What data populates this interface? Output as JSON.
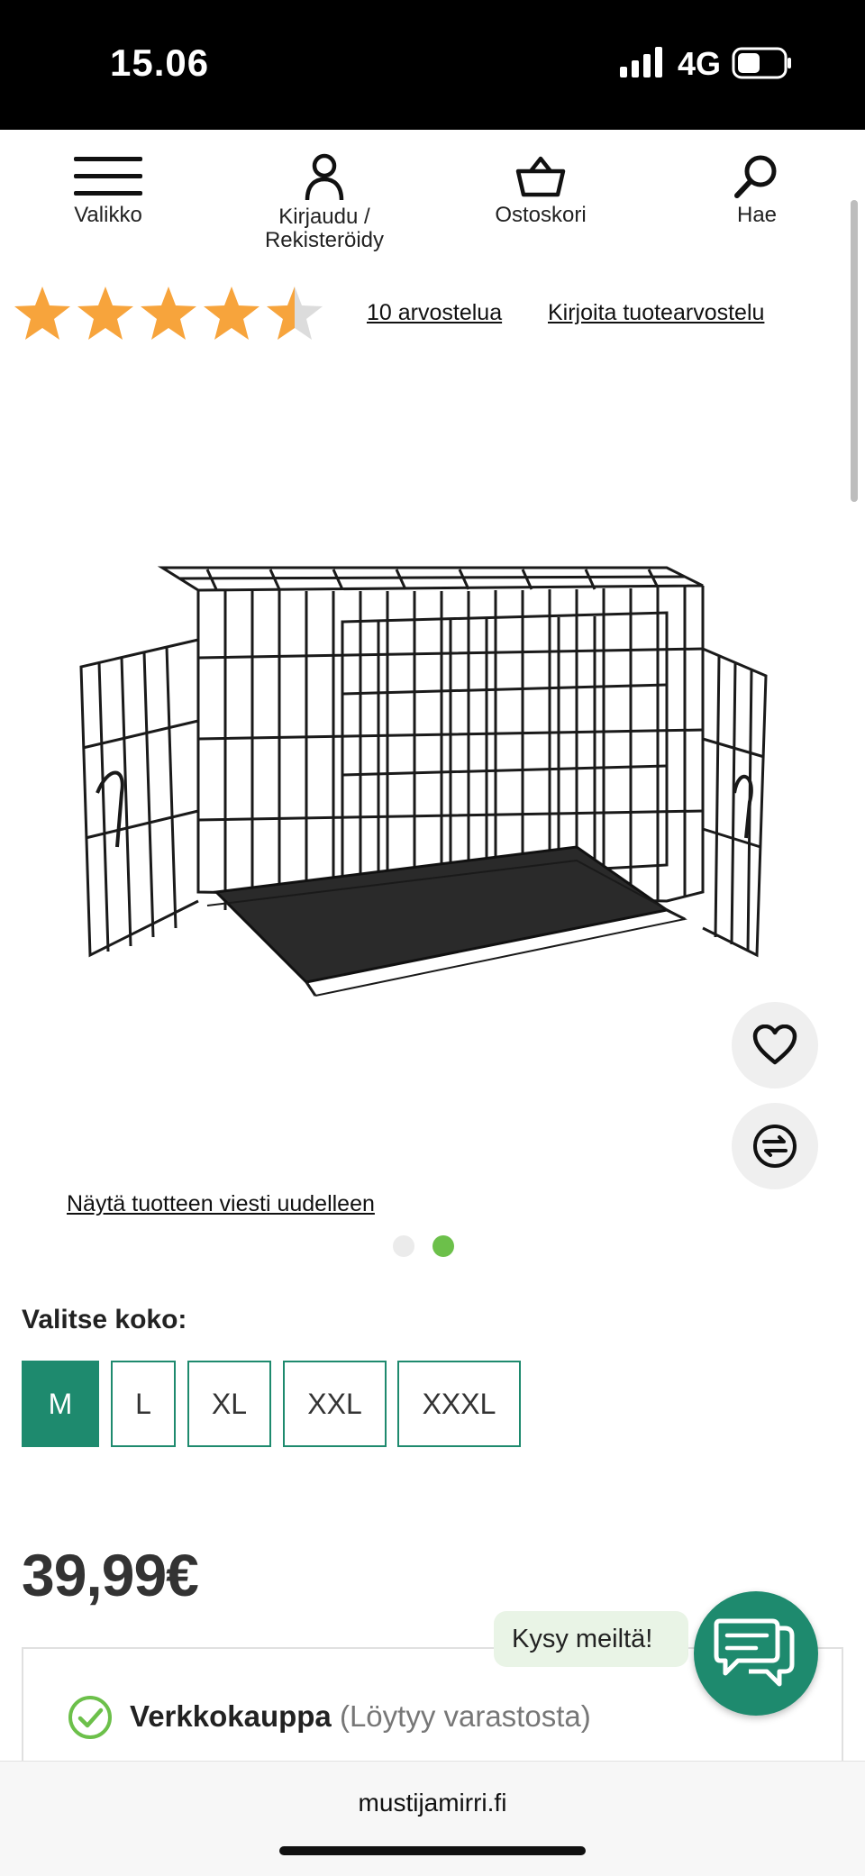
{
  "status": {
    "time": "15.06",
    "network": "4G"
  },
  "nav": {
    "menu": "Valikko",
    "login_line1": "Kirjaudu /",
    "login_line2": "Rekisteröidy",
    "cart": "Ostoskori",
    "search": "Hae"
  },
  "rating": {
    "value": 4.5,
    "max": 5,
    "reviews_link": "10 arvostelua",
    "write_link": "Kirjoita tuotearvostelu"
  },
  "gallery": {
    "show_message_link": "Näytä tuotteen viesti uudelleen",
    "slide_count": 2,
    "active_slide": 2
  },
  "size": {
    "label": "Valitse koko:",
    "options": [
      "M",
      "L",
      "XL",
      "XXL",
      "XXXL"
    ],
    "selected": "M"
  },
  "price": "39,99€",
  "stock": {
    "channel": "Verkkokauppa",
    "status": "(Löytyy varastosta)"
  },
  "chat": {
    "label": "Kysy meiltä!"
  },
  "browser": {
    "url": "mustijamirri.fi"
  },
  "colors": {
    "brand_green": "#1e8a6e",
    "star_orange": "#f7a43c",
    "dot_active": "#6cc04a"
  }
}
